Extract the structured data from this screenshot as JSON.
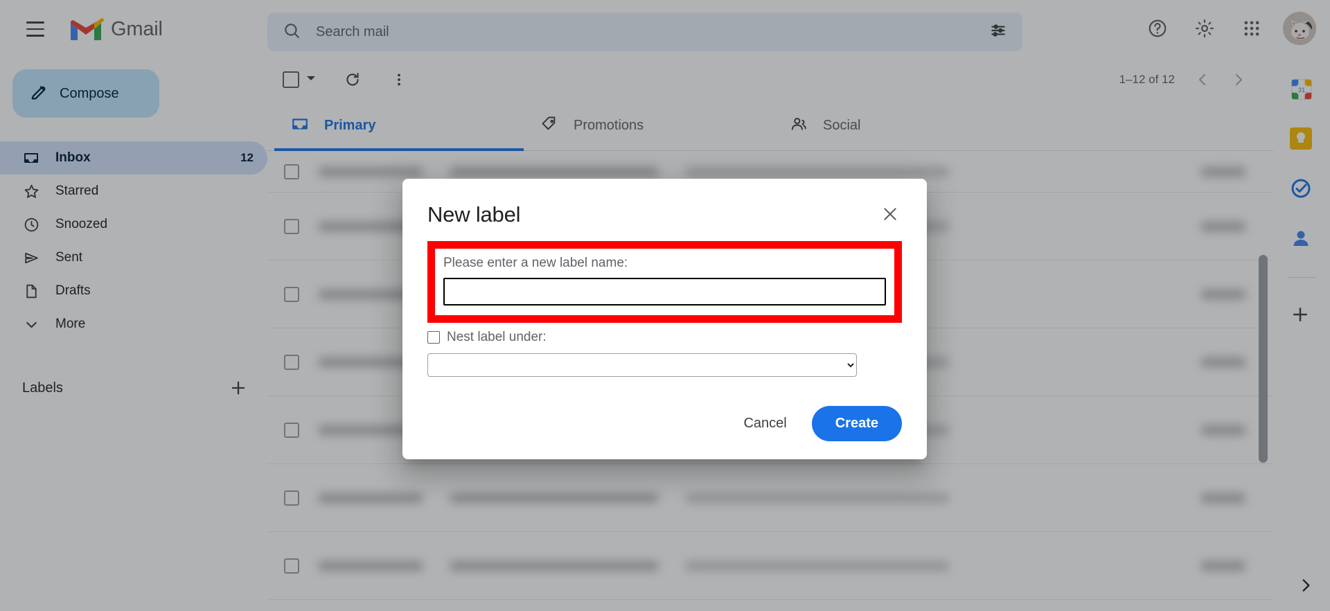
{
  "app": {
    "name": "Gmail",
    "menu_icon": "hamburger-icon"
  },
  "search": {
    "placeholder": "Search mail",
    "value": "",
    "search_icon": "search-icon",
    "filter_icon": "tune-icon"
  },
  "topbar_actions": {
    "help_icon": "help-circle-icon",
    "settings_icon": "gear-icon",
    "apps_icon": "apps-grid-icon",
    "avatar": "user-avatar"
  },
  "sidebar": {
    "compose": {
      "label": "Compose",
      "icon": "pencil-icon"
    },
    "items": [
      {
        "label": "Inbox",
        "icon": "inbox-icon",
        "count": "12",
        "active": true
      },
      {
        "label": "Starred",
        "icon": "star-icon",
        "count": "",
        "active": false
      },
      {
        "label": "Snoozed",
        "icon": "clock-icon",
        "count": "",
        "active": false
      },
      {
        "label": "Sent",
        "icon": "send-icon",
        "count": "",
        "active": false
      },
      {
        "label": "Drafts",
        "icon": "document-icon",
        "count": "",
        "active": false
      },
      {
        "label": "More",
        "icon": "chevron-down-icon",
        "count": "",
        "active": false
      }
    ],
    "labels_section": {
      "title": "Labels",
      "add_icon": "plus-icon"
    }
  },
  "toolbar": {
    "select_all_icon": "checkbox-icon",
    "select_caret_icon": "chevron-down-icon",
    "refresh_icon": "refresh-icon",
    "more_icon": "more-vertical-icon",
    "pagination": {
      "range": "1–12 of 12",
      "prev_icon": "chevron-left-icon",
      "next_icon": "chevron-right-icon"
    }
  },
  "tabs": [
    {
      "label": "Primary",
      "icon": "inbox-icon",
      "active": true
    },
    {
      "label": "Promotions",
      "icon": "tag-icon",
      "active": false
    },
    {
      "label": "Social",
      "icon": "people-icon",
      "active": false
    }
  ],
  "right_rail": {
    "items": [
      {
        "icon": "google-calendar-icon"
      },
      {
        "icon": "google-keep-icon"
      },
      {
        "icon": "google-tasks-icon"
      },
      {
        "icon": "google-contacts-icon"
      }
    ],
    "add_icon": "plus-icon",
    "expand_icon": "chevron-right-icon"
  },
  "dialog": {
    "title": "New label",
    "close_icon": "close-icon",
    "field_label": "Please enter a new label name:",
    "name_value": "",
    "name_placeholder": "",
    "nest_label": "Nest label under:",
    "nest_checked": false,
    "nest_select_value": "",
    "cancel_label": "Cancel",
    "create_label": "Create"
  },
  "annotation": {
    "highlight_color": "#ff0000",
    "target": "label-name-field"
  },
  "colors": {
    "accent_blue": "#1a73e8",
    "compose_bg": "#c2e7ff",
    "active_nav_bg": "#d3e3fd",
    "scrim": "rgba(32,33,36,0.35)"
  }
}
